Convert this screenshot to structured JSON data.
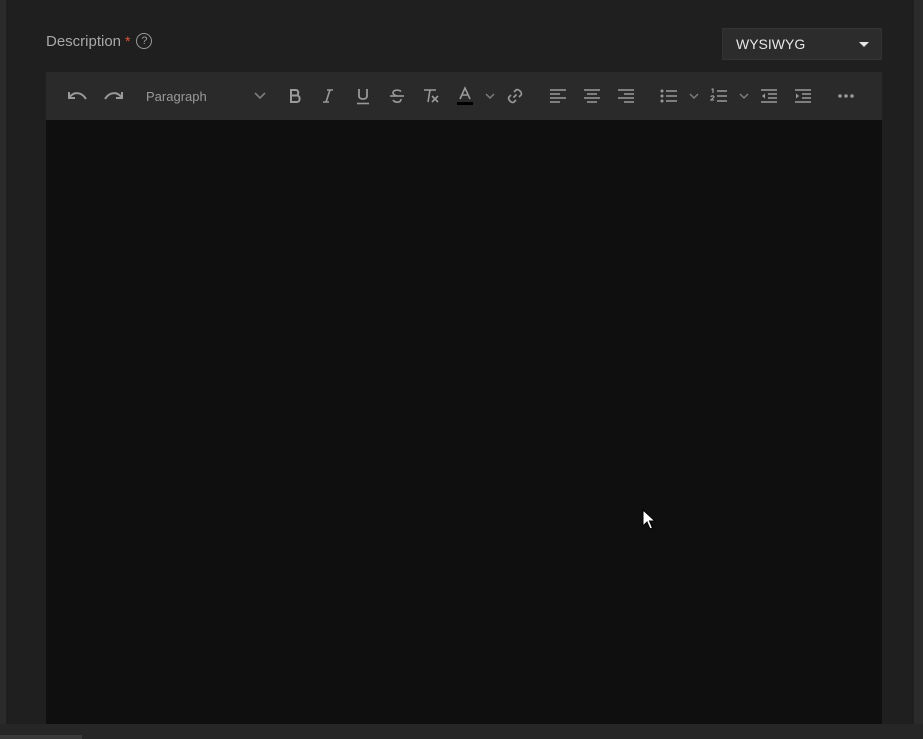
{
  "field": {
    "label": "Description",
    "required_mark": "*",
    "help_glyph": "?"
  },
  "mode_select": {
    "value": "WYSIWYG"
  },
  "toolbar": {
    "block_format": "Paragraph",
    "buttons": [
      "undo-icon",
      "redo-icon",
      "bold-icon",
      "italic-icon",
      "underline-icon",
      "strikethrough-icon",
      "clear-formatting-icon",
      "text-color-icon",
      "link-icon",
      "align-left-icon",
      "align-center-icon",
      "align-right-icon",
      "bullet-list-icon",
      "numbered-list-icon",
      "outdent-icon",
      "indent-icon",
      "more-icon"
    ]
  },
  "colors": {
    "background": "#1f1f1f",
    "editor": "#0f0f0f",
    "toolbar": "#2a2a2a",
    "required": "#e0523c"
  }
}
